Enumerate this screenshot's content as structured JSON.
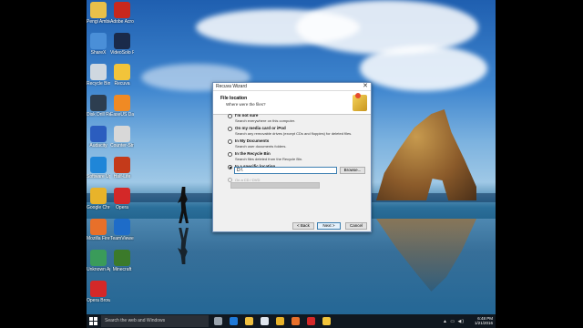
{
  "dialog": {
    "window_title": "Recuva Wizard",
    "close_glyph": "✕",
    "header_title": "File location",
    "header_subtitle": "Where were the files?",
    "wizard_icon": "recuva-wizard-icon",
    "options": [
      {
        "title": "I'm not sure",
        "desc": "Search everywhere on this computer.",
        "selected": false
      },
      {
        "title": "On my media card or iPod",
        "desc": "Search any removable drives (except CDs and floppies) for deleted files.",
        "selected": false
      },
      {
        "title": "In My Documents",
        "desc": "Search user documents folders.",
        "selected": false
      },
      {
        "title": "In the Recycle Bin",
        "desc": "Search files deleted from the Recycle Bin.",
        "selected": false
      },
      {
        "title": "In a specific location",
        "desc": "",
        "selected": true
      }
    ],
    "location_value": "D:\\",
    "browse_label": "Browse...",
    "cd_option_label": "On a CD / DVD",
    "back_label": "< Back",
    "next_label": "Next >",
    "cancel_label": "Cancel"
  },
  "desktop_icons": [
    {
      "label": "Pengi Ambidat Documen",
      "color": "#e8c04a"
    },
    {
      "label": "Adobe Acrobat",
      "color": "#c8281e"
    },
    {
      "label": "ShareX",
      "color": "#4a8fd8"
    },
    {
      "label": "VideoSolo Free",
      "color": "#1a2a4a"
    },
    {
      "label": "Recycle Bin",
      "color": "#cfd8e0"
    },
    {
      "label": "Recuva",
      "color": "#f2c43a"
    },
    {
      "label": "Disk Drill Recovery",
      "color": "#2d3e50"
    },
    {
      "label": "EaseUS Data Recovery",
      "color": "#f08a24"
    },
    {
      "label": "Audacity",
      "color": "#2b5dbf"
    },
    {
      "label": "Counter-Strike",
      "color": "#d8d8d8"
    },
    {
      "label": "Software Updater",
      "color": "#1f86d8"
    },
    {
      "label": "Half-Life",
      "color": "#c43a1a"
    },
    {
      "label": "Google Chrome",
      "color": "#e8b32a"
    },
    {
      "label": "Opera",
      "color": "#d42828"
    },
    {
      "label": "Mozilla Firefox",
      "color": "#e8702a"
    },
    {
      "label": "TeamViewer",
      "color": "#1e6cc8"
    },
    {
      "label": "Unknown App",
      "color": "#3a9b5a"
    },
    {
      "label": "Minecraft",
      "color": "#3b7a2a"
    },
    {
      "label": "Opera Browser",
      "color": "#d42828"
    }
  ],
  "taskbar": {
    "search_placeholder": "Search the web and Windows",
    "time": "6:48 PM",
    "date": "1/21/2016",
    "pinned": [
      {
        "icon": "task-view-icon",
        "color": "#9aa4ae"
      },
      {
        "icon": "edge-icon",
        "color": "#1f7ad8"
      },
      {
        "icon": "file-explorer-icon",
        "color": "#f0c040"
      },
      {
        "icon": "store-icon",
        "color": "#dfe6ee"
      },
      {
        "icon": "chrome-icon",
        "color": "#e8b32a"
      },
      {
        "icon": "firefox-icon",
        "color": "#e8702a"
      },
      {
        "icon": "opera-icon",
        "color": "#d42828"
      },
      {
        "icon": "recuva-icon",
        "color": "#f2c43a"
      }
    ]
  }
}
